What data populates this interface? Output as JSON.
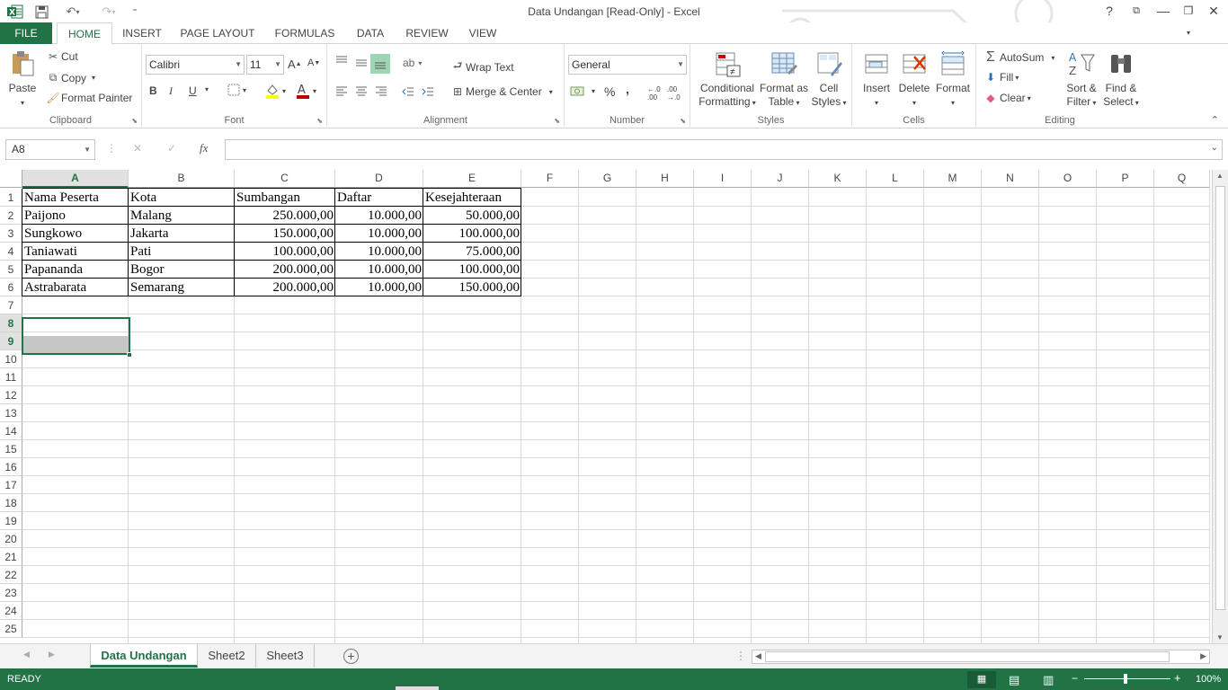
{
  "window": {
    "title": "Data Undangan  [Read-Only] - Excel"
  },
  "tabs": [
    "FILE",
    "HOME",
    "INSERT",
    "PAGE LAYOUT",
    "FORMULAS",
    "DATA",
    "REVIEW",
    "VIEW"
  ],
  "clipboard": {
    "paste": "Paste",
    "cut": "Cut",
    "copy": "Copy",
    "format_painter": "Format Painter",
    "label": "Clipboard"
  },
  "font": {
    "name": "Calibri",
    "size": "11",
    "bold": "B",
    "italic": "I",
    "underline": "U",
    "label": "Font"
  },
  "alignment": {
    "wrap": "Wrap Text",
    "merge": "Merge & Center",
    "label": "Alignment"
  },
  "number": {
    "format": "General",
    "percent": "%",
    "comma": ",",
    "label": "Number"
  },
  "styles": {
    "conditional": "Conditional",
    "conditional2": "Formatting",
    "format_as": "Format as",
    "format_as2": "Table",
    "cell": "Cell",
    "cell2": "Styles",
    "label": "Styles"
  },
  "cells": {
    "insert": "Insert",
    "delete": "Delete",
    "format": "Format",
    "label": "Cells"
  },
  "editing": {
    "autosum": "AutoSum",
    "fill": "Fill",
    "clear": "Clear",
    "sort": "Sort &",
    "sort2": "Filter",
    "find": "Find &",
    "find2": "Select",
    "label": "Editing"
  },
  "formula_bar": {
    "name_box": "A8",
    "fx": "fx",
    "value": ""
  },
  "columns": [
    "A",
    "B",
    "C",
    "D",
    "E",
    "F",
    "G",
    "H",
    "I",
    "J",
    "K",
    "L",
    "M",
    "N",
    "O",
    "P",
    "Q"
  ],
  "rows": [
    "1",
    "2",
    "3",
    "4",
    "5",
    "6",
    "7",
    "8",
    "9",
    "10",
    "11",
    "12",
    "13",
    "14",
    "15",
    "16",
    "17",
    "18",
    "19",
    "20",
    "21",
    "22",
    "23",
    "24",
    "25"
  ],
  "table": {
    "headers": [
      "Nama Peserta",
      "Kota",
      "Sumbangan",
      "Daftar",
      "Kesejahteraan"
    ],
    "rows": [
      [
        "Paijono",
        "Malang",
        "250.000,00",
        "10.000,00",
        "50.000,00"
      ],
      [
        "Sungkowo",
        "Jakarta",
        "150.000,00",
        "10.000,00",
        "100.000,00"
      ],
      [
        "Taniawati",
        "Pati",
        "100.000,00",
        "10.000,00",
        "75.000,00"
      ],
      [
        "Papananda",
        "Bogor",
        "200.000,00",
        "10.000,00",
        "100.000,00"
      ],
      [
        "Astrabarata",
        "Semarang",
        "200.000,00",
        "10.000,00",
        "150.000,00"
      ]
    ]
  },
  "sheets": [
    "Data Undangan",
    "Sheet2",
    "Sheet3"
  ],
  "status": {
    "ready": "READY",
    "zoom": "100%"
  },
  "colors": {
    "accent": "#217346"
  }
}
